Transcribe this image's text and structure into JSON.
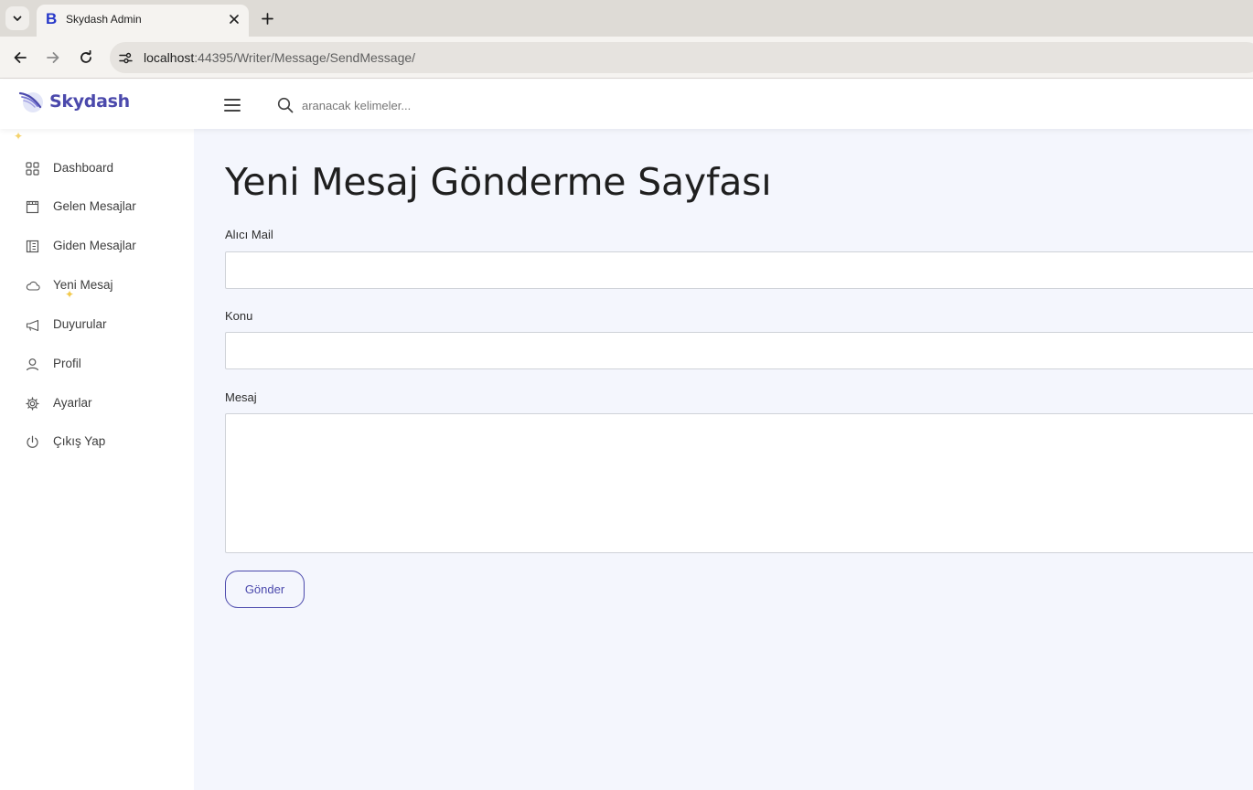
{
  "browser": {
    "tab_title": "Skydash Admin",
    "tab_favicon": "B",
    "url_host": "localhost",
    "url_rest": ":44395/Writer/Message/SendMessage/"
  },
  "header": {
    "brand": "Skydash",
    "search_placeholder": "aranacak kelimeler..."
  },
  "sidebar": {
    "items": [
      {
        "label": "Dashboard",
        "icon": "grid-icon"
      },
      {
        "label": "Gelen Mesajlar",
        "icon": "inbox-icon"
      },
      {
        "label": "Giden Mesajlar",
        "icon": "outbox-icon"
      },
      {
        "label": "Yeni Mesaj",
        "icon": "cloud-icon"
      },
      {
        "label": "Duyurular",
        "icon": "megaphone-icon"
      },
      {
        "label": "Profil",
        "icon": "user-icon"
      },
      {
        "label": "Ayarlar",
        "icon": "gear-icon"
      },
      {
        "label": "Çıkış Yap",
        "icon": "power-icon"
      }
    ]
  },
  "main": {
    "title": "Yeni Mesaj Gönderme Sayfası",
    "fields": {
      "recipient_label": "Alıcı Mail",
      "recipient_value": "",
      "subject_label": "Konu",
      "subject_value": "",
      "message_label": "Mesaj",
      "message_value": ""
    },
    "submit_label": "Gönder"
  },
  "colors": {
    "brand": "#4b49ac",
    "content_bg": "#f4f6fd",
    "sidebar_bg": "#ffffff"
  }
}
